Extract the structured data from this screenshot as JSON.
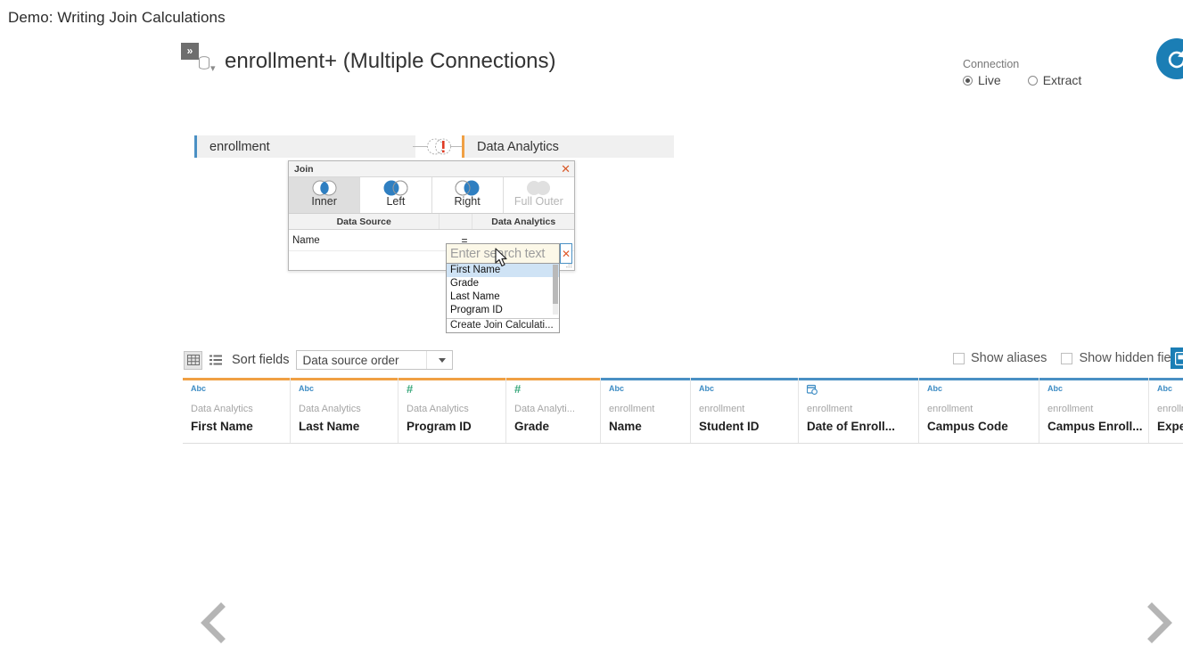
{
  "slide": {
    "title": "Demo: Writing Join Calculations"
  },
  "datasource": {
    "expand_icon": "double-chevron-right-icon",
    "db_icon": "database-icon",
    "title": "enrollment+ (Multiple Connections)"
  },
  "connection": {
    "label": "Connection",
    "options": [
      {
        "label": "Live",
        "selected": true
      },
      {
        "label": "Extract",
        "selected": false
      }
    ],
    "refresh_icon": "refresh-icon",
    "accent": "#1b7eb5"
  },
  "canvas": {
    "left_table": {
      "name": "enrollment",
      "accent": "#4a90c4"
    },
    "right_table": {
      "name": "Data Analytics",
      "accent": "#f0a044"
    },
    "join_link_icon": "join-venn-error-icon"
  },
  "join_popup": {
    "title": "Join",
    "close_icon": "close-icon",
    "types": [
      {
        "label": "Inner",
        "selected": true,
        "disabled": false,
        "icon": "venn-inner-icon"
      },
      {
        "label": "Left",
        "selected": false,
        "disabled": false,
        "icon": "venn-left-icon"
      },
      {
        "label": "Right",
        "selected": false,
        "disabled": false,
        "icon": "venn-right-icon"
      },
      {
        "label": "Full Outer",
        "selected": false,
        "disabled": true,
        "icon": "venn-full-outer-icon"
      }
    ],
    "columns": {
      "left": "Data Source",
      "operator": "",
      "right": "Data Analytics"
    },
    "clause": {
      "left_field": "Name",
      "operator": "=",
      "right_field_placeholder": "Enter search text",
      "right_field_value": "",
      "remove_icon": "close-icon"
    },
    "dropdown": {
      "items": [
        {
          "label": "First Name",
          "highlighted": true
        },
        {
          "label": "Grade",
          "highlighted": false
        },
        {
          "label": "Last Name",
          "highlighted": false
        },
        {
          "label": "Program ID",
          "highlighted": false
        }
      ],
      "create_item": "Create Join Calculati...",
      "scrollbar": "vertical-scrollbar"
    },
    "cursor_icon": "mouse-pointer-icon",
    "resize_icon": "resize-grip-icon"
  },
  "grid_toolbar": {
    "view_grid_icon": "grid-view-icon",
    "view_list_icon": "list-view-icon",
    "sort_label": "Sort fields",
    "sort_value": "Data source order",
    "sort_caret_icon": "chevron-down-icon",
    "checkboxes": [
      {
        "label": "Show aliases",
        "checked": false
      },
      {
        "label": "Show hidden fie",
        "checked": false
      }
    ],
    "corner_icon": "copy-icon"
  },
  "field_grid": {
    "columns": [
      {
        "type": "Abc",
        "type_kind": "text",
        "source": "Data Analytics",
        "name": "First Name",
        "accent": "#f0a044"
      },
      {
        "type": "Abc",
        "type_kind": "text",
        "source": "Data Analytics",
        "name": "Last Name",
        "accent": "#f0a044"
      },
      {
        "type": "#",
        "type_kind": "number",
        "source": "Data Analytics",
        "name": "Program ID",
        "accent": "#f0a044"
      },
      {
        "type": "#",
        "type_kind": "number",
        "source": "Data Analyti...",
        "name": "Grade",
        "accent": "#f0a044"
      },
      {
        "type": "Abc",
        "type_kind": "text",
        "source": "enrollment",
        "name": "Name",
        "accent": "#4a90c4"
      },
      {
        "type": "Abc",
        "type_kind": "text",
        "source": "enrollment",
        "name": "Student ID",
        "accent": "#4a90c4"
      },
      {
        "type": "cal",
        "type_kind": "date",
        "source": "enrollment",
        "name": "Date of Enroll...",
        "accent": "#4a90c4"
      },
      {
        "type": "Abc",
        "type_kind": "text",
        "source": "enrollment",
        "name": "Campus Code",
        "accent": "#4a90c4"
      },
      {
        "type": "Abc",
        "type_kind": "text",
        "source": "enrollment",
        "name": "Campus Enroll...",
        "accent": "#4a90c4"
      },
      {
        "type": "Abc",
        "type_kind": "text",
        "source": "enrollment",
        "name": "Expected Gra...",
        "accent": "#4a90c4"
      }
    ]
  },
  "navigation": {
    "prev_icon": "chevron-left-icon",
    "next_icon": "chevron-right-icon"
  }
}
